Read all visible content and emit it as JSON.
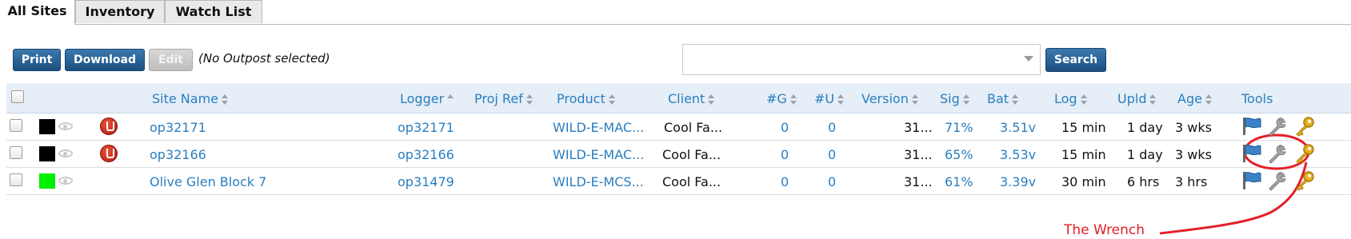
{
  "tabs": [
    {
      "label": "All Sites",
      "active": true
    },
    {
      "label": "Inventory",
      "active": false
    },
    {
      "label": "Watch List",
      "active": false
    }
  ],
  "toolbar": {
    "print": "Print",
    "download": "Download",
    "edit": "Edit",
    "selection_note": "(No Outpost selected)",
    "search_value": "",
    "search_button": "Search"
  },
  "columns": [
    "Site Name",
    "Logger",
    "Proj Ref",
    "Product",
    "Client",
    "#G",
    "#U",
    "Version",
    "Sig",
    "Bat",
    "Log",
    "Upld",
    "Age",
    "Tools"
  ],
  "rows": [
    {
      "color": "#000000",
      "alert": true,
      "site": "op32171",
      "logger": "op32171",
      "proj_ref": "",
      "product": "WILD-E-MAC...",
      "client": "Cool Fa...",
      "g": "0",
      "u": "0",
      "version": "31...",
      "sig": "71%",
      "bat": "3.51v",
      "log": "15 min",
      "upld": "1 day",
      "age": "3 wks"
    },
    {
      "color": "#000000",
      "alert": true,
      "site": "op32166",
      "logger": "op32166",
      "proj_ref": "",
      "product": "WILD-E-MAC...",
      "client": "Cool Fa...",
      "g": "0",
      "u": "0",
      "version": "31...",
      "sig": "65%",
      "bat": "3.53v",
      "log": "15 min",
      "upld": "1 day",
      "age": "3 wks"
    },
    {
      "color": "#00ee00",
      "alert": false,
      "site": "Olive Glen Block 7",
      "logger": "op31479",
      "proj_ref": "",
      "product": "WILD-E-MCS...",
      "client": "Cool Fa...",
      "g": "0",
      "u": "0",
      "version": "31...",
      "sig": "61%",
      "bat": "3.39v",
      "log": "30 min",
      "upld": "6 hrs",
      "age": "3 hrs"
    }
  ],
  "tools_icons": [
    "flag-icon",
    "wrench-icon",
    "key-icon"
  ],
  "annotation": {
    "label": "The Wrench",
    "color": "#e3202a"
  }
}
